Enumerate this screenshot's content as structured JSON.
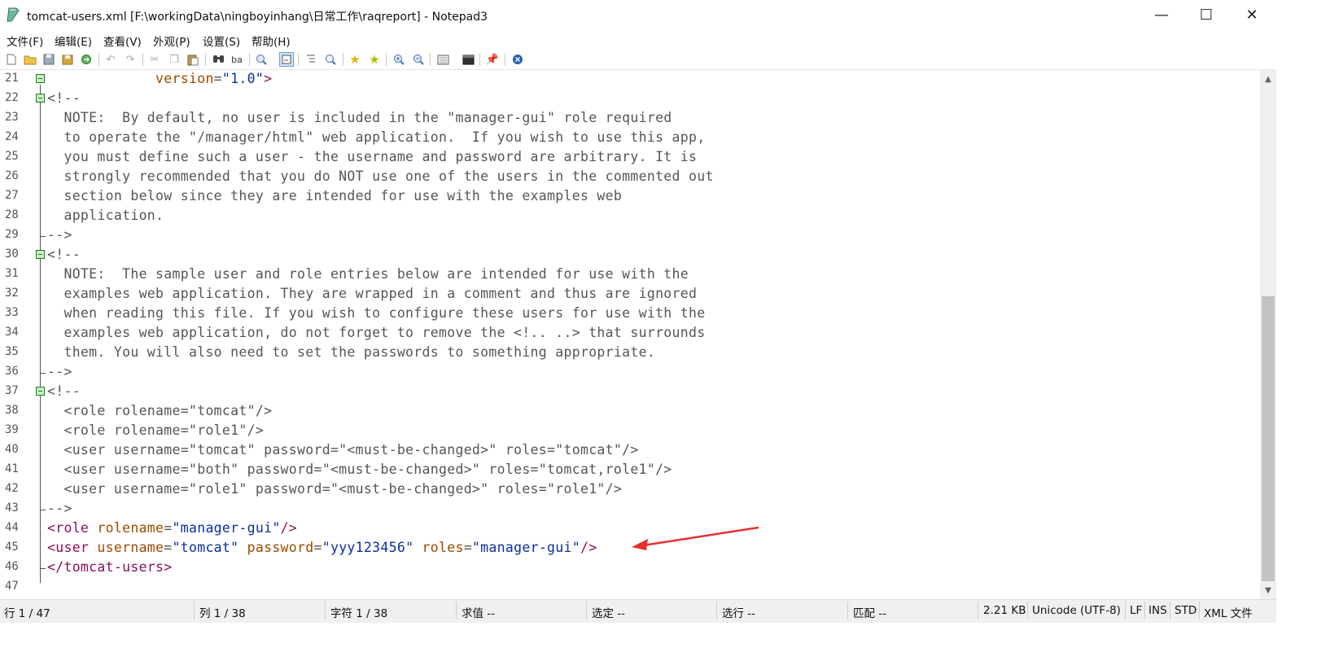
{
  "window": {
    "title": "tomcat-users.xml [F:\\workingData\\ningboyinhang\\日常工作\\raqreport] - Notepad3",
    "minimize": "—",
    "maximize": "☐",
    "close": "✕"
  },
  "menu": [
    "文件(F)",
    "编辑(E)",
    "查看(V)",
    "外观(P)",
    "设置(S)",
    "帮助(H)"
  ],
  "toolbar_icons": [
    "new-file-icon",
    "open-folder-icon",
    "save-icon",
    "save-as-icon",
    "refresh-icon",
    "undo-icon",
    "redo-icon",
    "cut-icon",
    "copy-icon",
    "paste-icon",
    "find-icon",
    "replace-icon",
    "zoom-page-icon",
    "word-wrap-icon",
    "indent-icon",
    "search-file-icon",
    "star-icon",
    "star-plus-icon",
    "zoom-in-icon",
    "zoom-out-icon",
    "schema-icon",
    "terminal-icon",
    "pin-icon",
    "close-circle-icon"
  ],
  "editor": {
    "lines": [
      {
        "n": "21",
        "fold": true,
        "parts": [
          [
            "",
            "             "
          ],
          [
            "c-attr",
            "version"
          ],
          [
            "c-com",
            "="
          ],
          [
            "c-str",
            "\"1.0\""
          ],
          [
            "c-tag",
            ">"
          ]
        ]
      },
      {
        "n": "22",
        "fold": true,
        "parts": [
          [
            "c-com",
            "<!--"
          ]
        ]
      },
      {
        "n": "23",
        "parts": [
          [
            "c-com",
            "  NOTE:  By default, no user is included in the \"manager-gui\" role required"
          ]
        ]
      },
      {
        "n": "24",
        "parts": [
          [
            "c-com",
            "  to operate the \"/manager/html\" web application.  If you wish to use this app,"
          ]
        ]
      },
      {
        "n": "25",
        "parts": [
          [
            "c-com",
            "  you must define such a user - the username and password are arbitrary. It is"
          ]
        ]
      },
      {
        "n": "26",
        "parts": [
          [
            "c-com",
            "  strongly recommended that you do NOT use one of the users in the commented out"
          ]
        ]
      },
      {
        "n": "27",
        "parts": [
          [
            "c-com",
            "  section below since they are intended for use with the examples web"
          ]
        ]
      },
      {
        "n": "28",
        "parts": [
          [
            "c-com",
            "  application."
          ]
        ]
      },
      {
        "n": "29",
        "parts": [
          [
            "c-com",
            "-->"
          ]
        ]
      },
      {
        "n": "30",
        "fold": true,
        "parts": [
          [
            "c-com",
            "<!--"
          ]
        ]
      },
      {
        "n": "31",
        "parts": [
          [
            "c-com",
            "  NOTE:  The sample user and role entries below are intended for use with the"
          ]
        ]
      },
      {
        "n": "32",
        "parts": [
          [
            "c-com",
            "  examples web application. They are wrapped in a comment and thus are ignored"
          ]
        ]
      },
      {
        "n": "33",
        "parts": [
          [
            "c-com",
            "  when reading this file. If you wish to configure these users for use with the"
          ]
        ]
      },
      {
        "n": "34",
        "parts": [
          [
            "c-com",
            "  examples web application, do not forget to remove the <!.. ..> that surrounds"
          ]
        ]
      },
      {
        "n": "35",
        "parts": [
          [
            "c-com",
            "  them. You will also need to set the passwords to something appropriate."
          ]
        ]
      },
      {
        "n": "36",
        "parts": [
          [
            "c-com",
            "-->"
          ]
        ]
      },
      {
        "n": "37",
        "fold": true,
        "parts": [
          [
            "c-com",
            "<!--"
          ]
        ]
      },
      {
        "n": "38",
        "parts": [
          [
            "c-com",
            "  <role rolename=\"tomcat\"/>"
          ]
        ]
      },
      {
        "n": "39",
        "parts": [
          [
            "c-com",
            "  <role rolename=\"role1\"/>"
          ]
        ]
      },
      {
        "n": "40",
        "parts": [
          [
            "c-com",
            "  <user username=\"tomcat\" password=\"<must-be-changed>\" roles=\"tomcat\"/>"
          ]
        ]
      },
      {
        "n": "41",
        "parts": [
          [
            "c-com",
            "  <user username=\"both\" password=\"<must-be-changed>\" roles=\"tomcat,role1\"/>"
          ]
        ]
      },
      {
        "n": "42",
        "parts": [
          [
            "c-com",
            "  <user username=\"role1\" password=\"<must-be-changed>\" roles=\"role1\"/>"
          ]
        ]
      },
      {
        "n": "43",
        "parts": [
          [
            "c-com",
            "-->"
          ]
        ]
      },
      {
        "n": "44",
        "parts": [
          [
            "c-tag",
            "<role "
          ],
          [
            "c-attr",
            "rolename"
          ],
          [
            "c-com",
            "="
          ],
          [
            "c-str",
            "\"manager-gui\""
          ],
          [
            "c-tag",
            "/>"
          ]
        ]
      },
      {
        "n": "45",
        "parts": [
          [
            "c-tag",
            "<user "
          ],
          [
            "c-attr",
            "username"
          ],
          [
            "c-com",
            "="
          ],
          [
            "c-str",
            "\"tomcat\" "
          ],
          [
            "c-attr",
            "password"
          ],
          [
            "c-com",
            "="
          ],
          [
            "c-str",
            "\"yyy123456\" "
          ],
          [
            "c-attr",
            "roles"
          ],
          [
            "c-com",
            "="
          ],
          [
            "c-str",
            "\"manager-gui\""
          ],
          [
            "c-tag",
            "/>"
          ]
        ]
      },
      {
        "n": "46",
        "parts": [
          [
            "c-tag",
            "</tomcat-users>"
          ]
        ]
      },
      {
        "n": "47",
        "parts": []
      }
    ]
  },
  "annotation": {
    "color": "#e8302f"
  },
  "status": {
    "line": "行 1 / 47",
    "col": "列 1 / 38",
    "char": "字符 1 / 38",
    "calc": "求值 --",
    "sel": "选定 --",
    "sel_lines": "选行 --",
    "match": "匹配 --",
    "size": "2.21 KB",
    "encoding": "Unicode (UTF-8)",
    "eol": "LF",
    "ins": "INS",
    "std": "STD",
    "lang": "XML 文件"
  }
}
